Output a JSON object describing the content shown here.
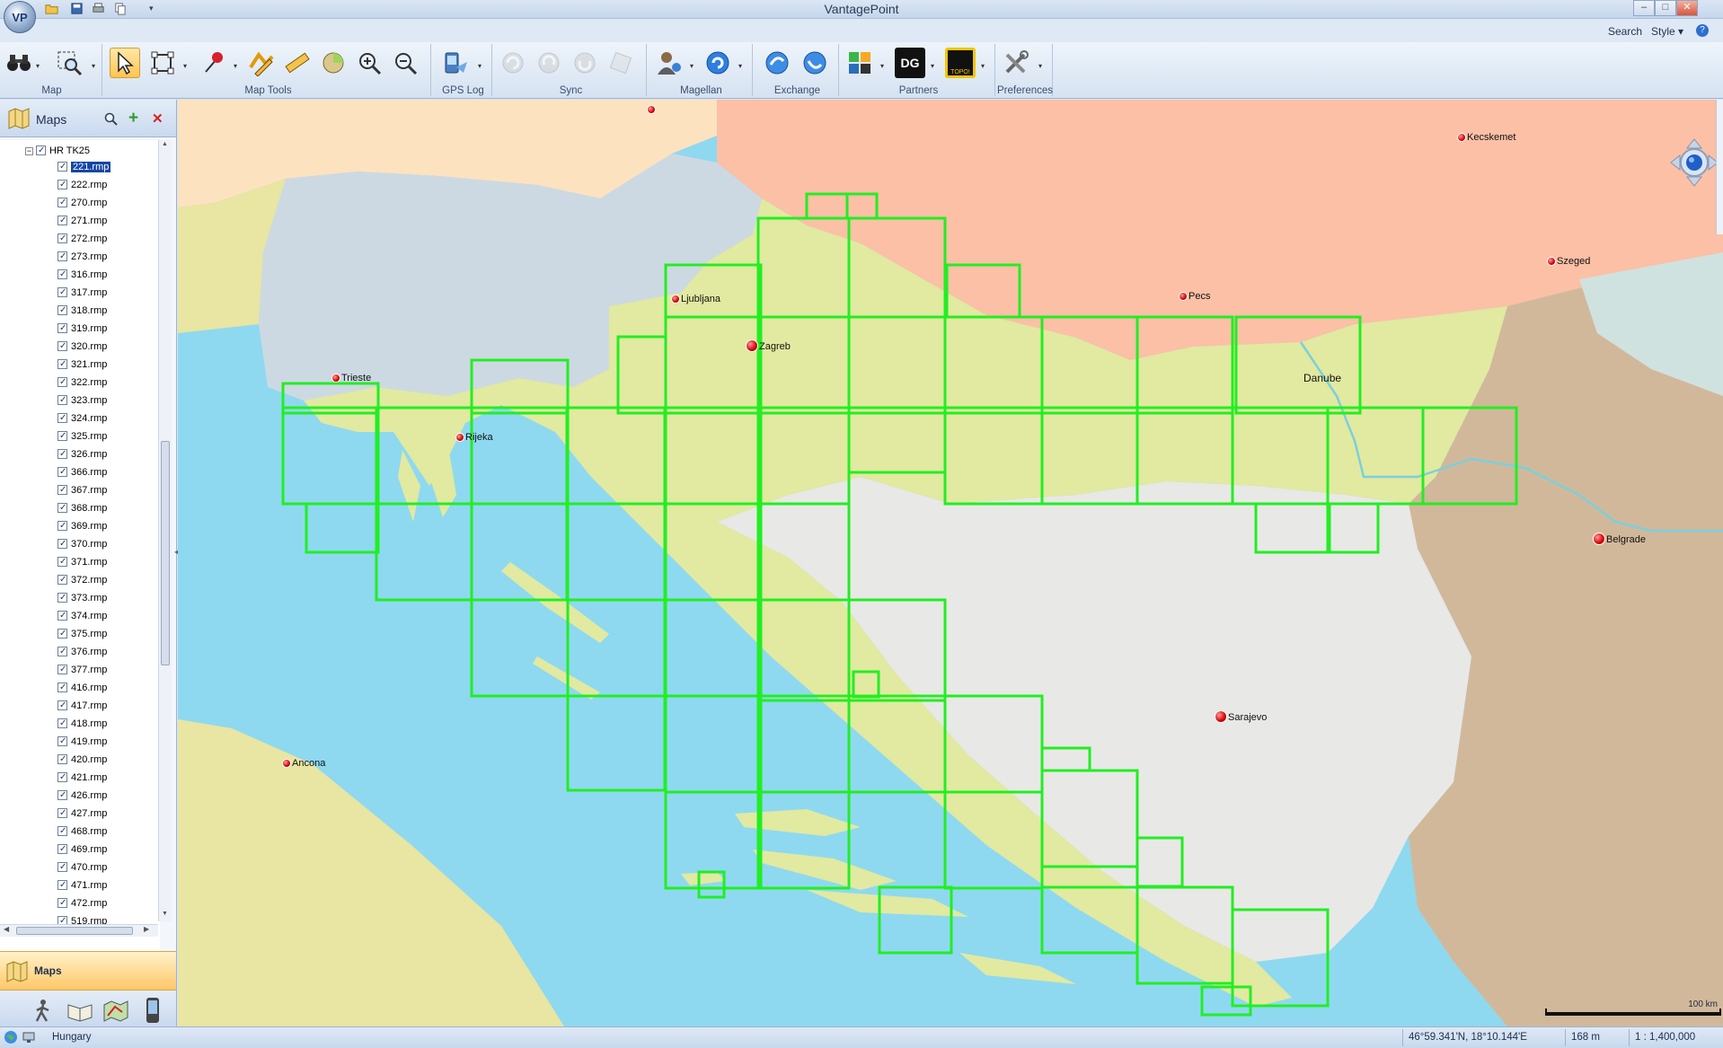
{
  "window": {
    "title": "VantagePoint",
    "orb_label": "VP",
    "min": "–",
    "max": "□",
    "close": "✕"
  },
  "menu": {
    "search": "Search",
    "style": "Style ▾",
    "help": "?"
  },
  "ribbon": {
    "groups": [
      "Map",
      "Map Tools",
      "GPS Log",
      "Sync",
      "Magellan",
      "Exchange",
      "Partners",
      "Preferences"
    ],
    "partner_dg": "DG",
    "partner_topo": "TOPO!"
  },
  "panel": {
    "title": "Maps",
    "tree_root": "HR TK25",
    "files": [
      "221.rmp",
      "222.rmp",
      "270.rmp",
      "271.rmp",
      "272.rmp",
      "273.rmp",
      "316.rmp",
      "317.rmp",
      "318.rmp",
      "319.rmp",
      "320.rmp",
      "321.rmp",
      "322.rmp",
      "323.rmp",
      "324.rmp",
      "325.rmp",
      "326.rmp",
      "366.rmp",
      "367.rmp",
      "368.rmp",
      "369.rmp",
      "370.rmp",
      "371.rmp",
      "372.rmp",
      "373.rmp",
      "374.rmp",
      "375.rmp",
      "376.rmp",
      "377.rmp",
      "416.rmp",
      "417.rmp",
      "418.rmp",
      "419.rmp",
      "420.rmp",
      "421.rmp",
      "426.rmp",
      "427.rmp",
      "468.rmp",
      "469.rmp",
      "470.rmp",
      "471.rmp",
      "472.rmp",
      "519.rmp"
    ],
    "selected_file": "221.rmp",
    "bottom_tab": "Maps"
  },
  "map": {
    "cities": [
      "Ljubljana",
      "Zagreb",
      "Trieste",
      "Rijeka",
      "Kecskemet",
      "Szeged",
      "Pecs",
      "Belgrade",
      "Sarajevo",
      "Ancona"
    ],
    "river_label": "Danube",
    "scale_label": "100 km",
    "colors": {
      "sea": "#8ed9f0",
      "croatia": "#e2e9a0",
      "slovenia": "#cdd9e2",
      "hungary": "#fbc0a6",
      "bosnia": "#e8e8e6",
      "serbia": "#d2b89a",
      "italy": "#e9e5a2",
      "austria": "#fde2c0",
      "tile_outline": "#22ee22"
    }
  },
  "status": {
    "location": "Hungary",
    "coords": "46°59.341'N, 18°10.144'E",
    "altitude": "168 m",
    "scale": "1 : 1,400,000"
  }
}
